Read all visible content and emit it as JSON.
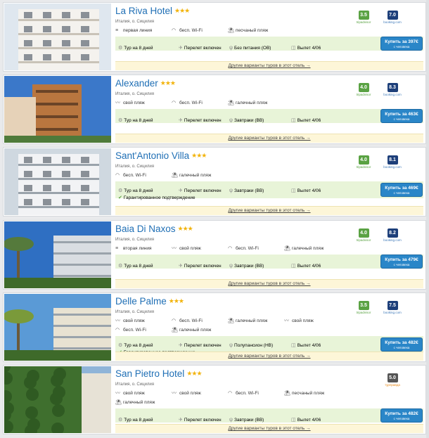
{
  "hotels": [
    {
      "name": "La Riva Hotel",
      "stars": "★★★",
      "location": "Италия, о. Сицилия",
      "features": [
        {
          "icon": "≡",
          "label": "первая линия"
        },
        {
          "icon": "◠",
          "label": "бесп. Wi-Fi"
        },
        {
          "icon": "⛱",
          "label": "песчаный пляж"
        }
      ],
      "ratings": [
        {
          "kind": "ta",
          "value": "3.5",
          "source": "tripadvisor"
        },
        {
          "kind": "bk",
          "value": "7.0",
          "source": "booking.com"
        }
      ],
      "tour_lines": [
        [
          {
            "icon": "⚙",
            "label": "Тур на 8 дней"
          },
          {
            "icon": "✈",
            "label": "Перелет включен"
          },
          {
            "icon": "ψ",
            "label": "Без питания (OB)"
          },
          {
            "icon": "◫",
            "label": "Вылет 4/06"
          }
        ]
      ],
      "buy_label": "Купить за 397€",
      "buy_sub": "с человека",
      "more": "Другие варианты туров в этот отель →"
    },
    {
      "name": "Alexander",
      "stars": "★★★",
      "location": "Италия, о. Сицилия",
      "features": [
        {
          "icon": "〰",
          "label": "свой пляж"
        },
        {
          "icon": "◠",
          "label": "бесп. Wi-Fi"
        },
        {
          "icon": "⛱",
          "label": "галечный пляж"
        }
      ],
      "ratings": [
        {
          "kind": "ta",
          "value": "4.0",
          "source": "tripadvisor"
        },
        {
          "kind": "bk",
          "value": "8.3",
          "source": "booking.com"
        }
      ],
      "tour_lines": [
        [
          {
            "icon": "⚙",
            "label": "Тур на 8 дней"
          },
          {
            "icon": "✈",
            "label": "Перелет включен"
          },
          {
            "icon": "ψ",
            "label": "Завтраки (BB)"
          },
          {
            "icon": "◫",
            "label": "Вылет 4/06"
          }
        ]
      ],
      "buy_label": "Купить за 463€",
      "buy_sub": "с человека",
      "more": "Другие варианты туров в этот отель →"
    },
    {
      "name": "Sant'Antonio Villa",
      "stars": "★★★",
      "location": "Италия, о. Сицилия",
      "features": [
        {
          "icon": "◠",
          "label": "бесп. Wi-Fi"
        },
        {
          "icon": "⛱",
          "label": "галечный пляж"
        }
      ],
      "ratings": [
        {
          "kind": "ta",
          "value": "4.0",
          "source": "tripadvisor"
        },
        {
          "kind": "bk",
          "value": "8.1",
          "source": "booking.com"
        }
      ],
      "tour_lines": [
        [
          {
            "icon": "⚙",
            "label": "Тур на 8 дней"
          },
          {
            "icon": "✈",
            "label": "Перелет включен"
          },
          {
            "icon": "ψ",
            "label": "Завтраки (BB)"
          },
          {
            "icon": "◫",
            "label": "Вылет 4/06"
          }
        ],
        [
          {
            "icon": "✔",
            "label": "Гарантированное подтверждение",
            "check": true
          }
        ]
      ],
      "buy_label": "Купить за 469€",
      "buy_sub": "с человека",
      "more": "Другие варианты туров в этот отель →"
    },
    {
      "name": "Baia Di Naxos",
      "stars": "★★★",
      "location": "Италия, о. Сицилия",
      "features": [
        {
          "icon": "≡",
          "label": "вторая линия"
        },
        {
          "icon": "〰",
          "label": "свой пляж"
        },
        {
          "icon": "◠",
          "label": "бесп. Wi-Fi"
        },
        {
          "icon": "⛱",
          "label": "галечный пляж"
        }
      ],
      "ratings": [
        {
          "kind": "ta",
          "value": "4.0",
          "source": "tripadvisor"
        },
        {
          "kind": "bk",
          "value": "8.2",
          "source": "booking.com"
        }
      ],
      "tour_lines": [
        [
          {
            "icon": "⚙",
            "label": "Тур на 8 дней"
          },
          {
            "icon": "✈",
            "label": "Перелет включен"
          },
          {
            "icon": "ψ",
            "label": "Завтраки (BB)"
          },
          {
            "icon": "◫",
            "label": "Вылет 4/06"
          }
        ]
      ],
      "buy_label": "Купить за 479€",
      "buy_sub": "с человека",
      "more": "Другие варианты туров в этот отель →"
    },
    {
      "name": "Delle Palme",
      "stars": "★★★",
      "location": "Италия, о. Сицилия",
      "features": [
        {
          "icon": "〰",
          "label": "свой пляж"
        },
        {
          "icon": "◠",
          "label": "бесп. Wi-Fi"
        },
        {
          "icon": "⛱",
          "label": "галечный пляж"
        },
        {
          "icon": "〰",
          "label": "свой пляж"
        },
        {
          "icon": "◠",
          "label": "бесп. Wi-Fi"
        },
        {
          "icon": "⛱",
          "label": "галечный пляж"
        }
      ],
      "ratings": [
        {
          "kind": "ta",
          "value": "3.5",
          "source": "tripadvisor"
        },
        {
          "kind": "bk",
          "value": "7.5",
          "source": "booking.com"
        }
      ],
      "tour_lines": [
        [
          {
            "icon": "⚙",
            "label": "Тур на 8 дней"
          },
          {
            "icon": "✈",
            "label": "Перелет включен"
          },
          {
            "icon": "ψ",
            "label": "Полупансион (HB)"
          },
          {
            "icon": "◫",
            "label": "Вылет 4/06"
          }
        ],
        [
          {
            "icon": "✔",
            "label": "Гарантированное подтверждение",
            "check": true
          }
        ]
      ],
      "buy_label": "Купить за 482€",
      "buy_sub": "с человека",
      "more": "Другие варианты туров в этот отель →"
    },
    {
      "name": "San Pietro Hotel",
      "stars": "★★★",
      "location": "Италия, о. Сицилия",
      "features": [
        {
          "icon": "〰",
          "label": "свой пляж"
        },
        {
          "icon": "〰",
          "label": "свой пляж"
        },
        {
          "icon": "◠",
          "label": "бесп. Wi-Fi"
        },
        {
          "icon": "⛱",
          "label": "песчаный пляж"
        },
        {
          "icon": "⛱",
          "label": "галечный пляж"
        }
      ],
      "ratings": [
        {
          "kind": "tp",
          "value": "5.0",
          "source": "турправда"
        }
      ],
      "tour_lines": [
        [
          {
            "icon": "⚙",
            "label": "Тур на 8 дней"
          },
          {
            "icon": "✈",
            "label": "Перелет включен"
          },
          {
            "icon": "ψ",
            "label": "Завтраки (BB)"
          },
          {
            "icon": "◫",
            "label": "Вылет 4/06"
          }
        ]
      ],
      "buy_label": "Купить за 482€",
      "buy_sub": "с человека",
      "more": "Другие варианты туров в этот отель →"
    }
  ]
}
